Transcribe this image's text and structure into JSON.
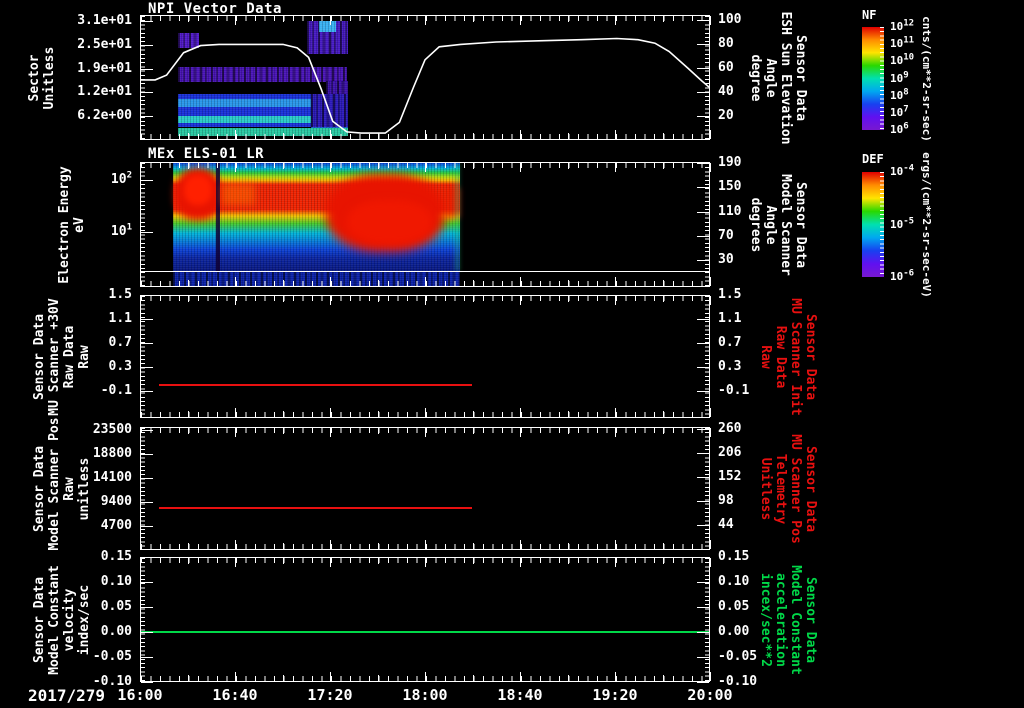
{
  "date_label": "2017/279",
  "time_axis": {
    "start_hour": 16,
    "end_hour": 20,
    "tick_labels": [
      "16:00",
      "16:40",
      "17:20",
      "18:00",
      "18:40",
      "19:20",
      "20:00"
    ]
  },
  "colors": {
    "background": "#000000",
    "axis": "#ffffff",
    "red_series": "#e81010",
    "green_series": "#00d848",
    "white_line": "#ffffff"
  },
  "colorbars": [
    {
      "id": "nf",
      "title": "NF",
      "label_base": "10",
      "exponents": [
        "12",
        "11",
        "10",
        "9",
        "8",
        "7",
        "6"
      ],
      "unit": "cnts/(cm**2-sr-sec)",
      "gradient_stops": [
        "#e00000",
        "#ff8c00",
        "#ffe400",
        "#28d800",
        "#00e0b0",
        "#00a8f0",
        "#1840f0",
        "#6010f0",
        "#7818d0"
      ]
    },
    {
      "id": "def",
      "title": "DEF",
      "label_base": "10",
      "exponents": [
        "-4",
        "-5",
        "-6"
      ],
      "unit": "ergs/(cm**2-sr-sec-eV)",
      "gradient_stops": [
        "#e00000",
        "#ff8c00",
        "#ffe400",
        "#28d800",
        "#00e0b0",
        "#00a8f0",
        "#1840f0",
        "#6010f0",
        "#7818d0"
      ]
    }
  ],
  "chart_data": [
    {
      "id": "npi",
      "type": "heatmap+line",
      "title": "NPI Vector Data",
      "time_range": [
        16,
        20
      ],
      "left_axis": {
        "title_lines": [
          "Sector",
          "Unitless"
        ],
        "scale": "linear",
        "range": [
          0,
          32.6
        ],
        "ticks": [
          {
            "v": 31,
            "label": "3.1e+01"
          },
          {
            "v": 24.8,
            "label": "2.5e+01"
          },
          {
            "v": 18.6,
            "label": "1.9e+01"
          },
          {
            "v": 12.4,
            "label": "1.2e+01"
          },
          {
            "v": 6.2,
            "label": "6.2e+00"
          }
        ]
      },
      "right_axis": {
        "title_lines": [
          "Sensor Data",
          "ESH Sun Elevation",
          "Angle",
          "degree"
        ],
        "color": "#ffffff",
        "scale": "linear",
        "range": [
          0,
          104
        ],
        "ticks": [
          {
            "v": 100,
            "label": "100"
          },
          {
            "v": 80,
            "label": "80"
          },
          {
            "v": 60,
            "label": "60"
          },
          {
            "v": 40,
            "label": "40"
          },
          {
            "v": 20,
            "label": "20"
          }
        ]
      },
      "line_series": {
        "name": "ESH Sun Elevation Angle",
        "color": "#ffffff",
        "points": [
          [
            16.0,
            50
          ],
          [
            16.1,
            50
          ],
          [
            16.18,
            54
          ],
          [
            16.3,
            73
          ],
          [
            16.42,
            79
          ],
          [
            16.55,
            80
          ],
          [
            17.0,
            80
          ],
          [
            17.1,
            77
          ],
          [
            17.18,
            69
          ],
          [
            17.27,
            42
          ],
          [
            17.35,
            15
          ],
          [
            17.45,
            6
          ],
          [
            17.55,
            5
          ],
          [
            17.72,
            5
          ],
          [
            17.82,
            14
          ],
          [
            17.92,
            44
          ],
          [
            18.0,
            67
          ],
          [
            18.1,
            78
          ],
          [
            18.25,
            80
          ],
          [
            18.5,
            82
          ],
          [
            18.8,
            83
          ],
          [
            19.1,
            84
          ],
          [
            19.35,
            85
          ],
          [
            19.5,
            84
          ],
          [
            19.62,
            81
          ],
          [
            19.72,
            74
          ],
          [
            19.85,
            60
          ],
          [
            19.95,
            49
          ],
          [
            20.0,
            44
          ]
        ]
      },
      "heatmap_blocks": [
        {
          "t": [
            16.26,
            16.41
          ],
          "s": [
            24,
            28
          ],
          "color": "#5018c8",
          "speckle": true
        },
        {
          "t": [
            16.26,
            17.45
          ],
          "s": [
            15.2,
            19
          ],
          "color": "#4712b4",
          "speckle": true
        },
        {
          "t": [
            17.17,
            17.46
          ],
          "s": [
            22.5,
            31.3
          ],
          "color": "#4418c0",
          "speckle": true
        },
        {
          "t": [
            17.25,
            17.37
          ],
          "s": [
            28.3,
            31.3
          ],
          "color": "#38b0f0"
        },
        {
          "t": [
            17.3,
            17.46
          ],
          "s": [
            11,
            15.5
          ],
          "color": "#3a10a8",
          "speckle": true
        },
        {
          "t": [
            16.26,
            17.2
          ],
          "s": [
            3.3,
            12
          ],
          "color": "#1830d8"
        },
        {
          "t": [
            16.26,
            17.2
          ],
          "s": [
            8.6,
            10.6
          ],
          "color": "#2896e8"
        },
        {
          "t": [
            16.26,
            17.2
          ],
          "s": [
            4.2,
            6.2
          ],
          "color": "#28ccc8"
        },
        {
          "t": [
            17.2,
            17.46
          ],
          "s": [
            3.3,
            12
          ],
          "color": "#2a18b8",
          "speckle": true
        },
        {
          "t": [
            17.2,
            17.46
          ],
          "s": [
            1,
            3.3
          ],
          "color": "#2060d0"
        },
        {
          "t": [
            16.26,
            17.46
          ],
          "s": [
            0.7,
            2.9
          ],
          "color": "#28c8a0"
        }
      ]
    },
    {
      "id": "els",
      "type": "spectrogram",
      "title": "MEx ELS-01 LR",
      "time_range": [
        16,
        20
      ],
      "left_axis": {
        "title_lines": [
          "Electron Energy",
          "eV"
        ],
        "scale": "log",
        "range": [
          0.87,
          222
        ],
        "ticks": [
          {
            "v": 100,
            "label_base": "10",
            "label_exp": "2"
          },
          {
            "v": 10,
            "label_base": "10",
            "label_exp": "1"
          }
        ]
      },
      "right_axis": {
        "title_lines": [
          "Sensor Data",
          "Model Scanner",
          "Angle",
          "degrees"
        ],
        "color": "#ffffff",
        "scale": "linear",
        "range": [
          -13.5,
          191
        ],
        "ticks": [
          {
            "v": 190,
            "label": "190"
          },
          {
            "v": 150,
            "label": "150"
          },
          {
            "v": 110,
            "label": "110"
          },
          {
            "v": 70,
            "label": "70"
          },
          {
            "v": 30,
            "label": "30"
          }
        ]
      },
      "spectrogram": {
        "t_range": [
          16.225,
          18.25
        ],
        "divider_frac": 0.88,
        "bottom_strip": {
          "color": "#0a20a8"
        },
        "base_gradient": [
          [
            "0%",
            "#0b42d6"
          ],
          [
            "5%",
            "#00b4d8"
          ],
          [
            "9%",
            "#28c83c"
          ],
          [
            "13%",
            "#b4d810"
          ],
          [
            "16%",
            "#f0b400"
          ],
          [
            "20%",
            "#ee2200"
          ],
          [
            "43%",
            "#ee2200"
          ],
          [
            "49%",
            "#f0c000"
          ],
          [
            "56%",
            "#46c828"
          ],
          [
            "65%",
            "#00b4d8"
          ],
          [
            "80%",
            "#0b42d6"
          ],
          [
            "88%",
            "#0a24a0"
          ],
          [
            "100%",
            "#081880"
          ]
        ],
        "features": [
          {
            "t": [
              16.24,
              16.56
            ],
            "y": [
              "4%",
              "46%"
            ],
            "color": "#e81400",
            "blur": 4,
            "round": true
          },
          {
            "t": [
              16.3,
              16.5
            ],
            "y": [
              "10%",
              "34%"
            ],
            "color": "#ff2000",
            "blur": 3,
            "round": true
          },
          {
            "t": [
              16.525,
              16.555
            ],
            "y": [
              "0%",
              "88%"
            ],
            "color": "rgba(15,0,50,0.85)"
          },
          {
            "t": [
              16.56,
              16.8
            ],
            "y": [
              "16%",
              "34%"
            ],
            "color": "rgba(255,120,0,0.45)",
            "blur": 4
          },
          {
            "t": [
              17.3,
              18.14
            ],
            "y": [
              "9%",
              "72%"
            ],
            "color": "#e81400",
            "blur": 5,
            "round": true
          },
          {
            "t": [
              17.45,
              18.05
            ],
            "y": [
              "30%",
              "66%"
            ],
            "color": "#f01800",
            "blur": 4,
            "round": true
          },
          {
            "t": [
              18.14,
              18.25
            ],
            "y": [
              "20%",
              "45%"
            ],
            "color": "rgba(232,30,0,0.6)",
            "blur": 3
          },
          {
            "t": [
              18.21,
              18.25
            ],
            "y": [
              "0%",
              "88%"
            ],
            "color": "rgba(30,190,110,0.35)",
            "blur": 2
          }
        ]
      }
    },
    {
      "id": "mu30v",
      "type": "line",
      "title": "",
      "time_range": [
        16,
        20
      ],
      "left_axis": {
        "title_lines": [
          "Sensor Data",
          "MU Scanner +30V",
          "Raw Data",
          "Raw"
        ],
        "scale": "linear",
        "range": [
          -0.54,
          1.5
        ],
        "ticks": [
          {
            "v": 1.5,
            "label": "1.5"
          },
          {
            "v": 1.1,
            "label": "1.1"
          },
          {
            "v": 0.7,
            "label": "0.7"
          },
          {
            "v": 0.3,
            "label": "0.3"
          },
          {
            "v": -0.1,
            "label": "-0.1"
          }
        ]
      },
      "right_axis": {
        "title_lines": [
          "Sensor Data",
          "MU Scanner Init",
          "Raw Data",
          "Raw"
        ],
        "color": "#e81010",
        "scale": "linear",
        "range": [
          -0.54,
          1.5
        ],
        "ticks": [
          {
            "v": 1.5,
            "label": "1.5"
          },
          {
            "v": 1.1,
            "label": "1.1"
          },
          {
            "v": 0.7,
            "label": "0.7"
          },
          {
            "v": 0.3,
            "label": "0.3"
          },
          {
            "v": -0.1,
            "label": "-0.1"
          }
        ]
      },
      "series": [
        {
          "name": "MU Scanner +30V Raw",
          "color": "#e81010",
          "value": 0.0,
          "t_start": 16.13,
          "t_end": 18.33
        }
      ]
    },
    {
      "id": "mspos",
      "type": "line",
      "title": "",
      "time_range": [
        16,
        20
      ],
      "left_axis": {
        "title_lines": [
          "Sensor Data",
          "Model Scanner Pos",
          "Raw",
          "unitless"
        ],
        "scale": "linear",
        "range": [
          -100,
          24000
        ],
        "ticks": [
          {
            "v": 23500,
            "label": "23500"
          },
          {
            "v": 18800,
            "label": "18800"
          },
          {
            "v": 14100,
            "label": "14100"
          },
          {
            "v": 9400,
            "label": "9400"
          },
          {
            "v": 4700,
            "label": "4700"
          }
        ]
      },
      "right_axis": {
        "title_lines": [
          "Sensor Data",
          "MU Scanner Pos",
          "Telemetry",
          "Unitless"
        ],
        "color": "#e81010",
        "scale": "linear",
        "range": [
          -12,
          265
        ],
        "ticks": [
          {
            "v": 260,
            "label": "260"
          },
          {
            "v": 206,
            "label": "206"
          },
          {
            "v": 152,
            "label": "152"
          },
          {
            "v": 98,
            "label": "98"
          },
          {
            "v": 44,
            "label": "44"
          }
        ]
      },
      "series": [
        {
          "name": "Model Scanner Pos Raw",
          "color": "#e81010",
          "value": 8000,
          "t_start": 16.13,
          "t_end": 18.33
        }
      ]
    },
    {
      "id": "mconst",
      "type": "line",
      "title": "",
      "time_range": [
        16,
        20
      ],
      "left_axis": {
        "title_lines": [
          "Sensor Data",
          "Model Constant",
          "velocity",
          "index/sec"
        ],
        "scale": "linear",
        "range": [
          -0.1,
          0.15
        ],
        "ticks": [
          {
            "v": 0.15,
            "label": "0.15"
          },
          {
            "v": 0.1,
            "label": "0.10"
          },
          {
            "v": 0.05,
            "label": "0.05"
          },
          {
            "v": 0.0,
            "label": "0.00"
          },
          {
            "v": -0.05,
            "label": "-0.05"
          },
          {
            "v": -0.1,
            "label": "-0.10"
          }
        ]
      },
      "right_axis": {
        "title_lines": [
          "Sensor Data",
          "Model Constant",
          "acceleration",
          "incex/sec**2"
        ],
        "color": "#00d848",
        "scale": "linear",
        "range": [
          -0.1,
          0.15
        ],
        "ticks": [
          {
            "v": 0.15,
            "label": "0.15"
          },
          {
            "v": 0.1,
            "label": "0.10"
          },
          {
            "v": 0.05,
            "label": "0.05"
          },
          {
            "v": 0.0,
            "label": "0.00"
          },
          {
            "v": -0.05,
            "label": "-0.05"
          },
          {
            "v": -0.1,
            "label": "-0.10"
          }
        ]
      },
      "series": [
        {
          "name": "Model Constant velocity",
          "color": "#00d848",
          "value": 0.0,
          "t_start": 16.0,
          "t_end": 20.0
        }
      ]
    }
  ]
}
